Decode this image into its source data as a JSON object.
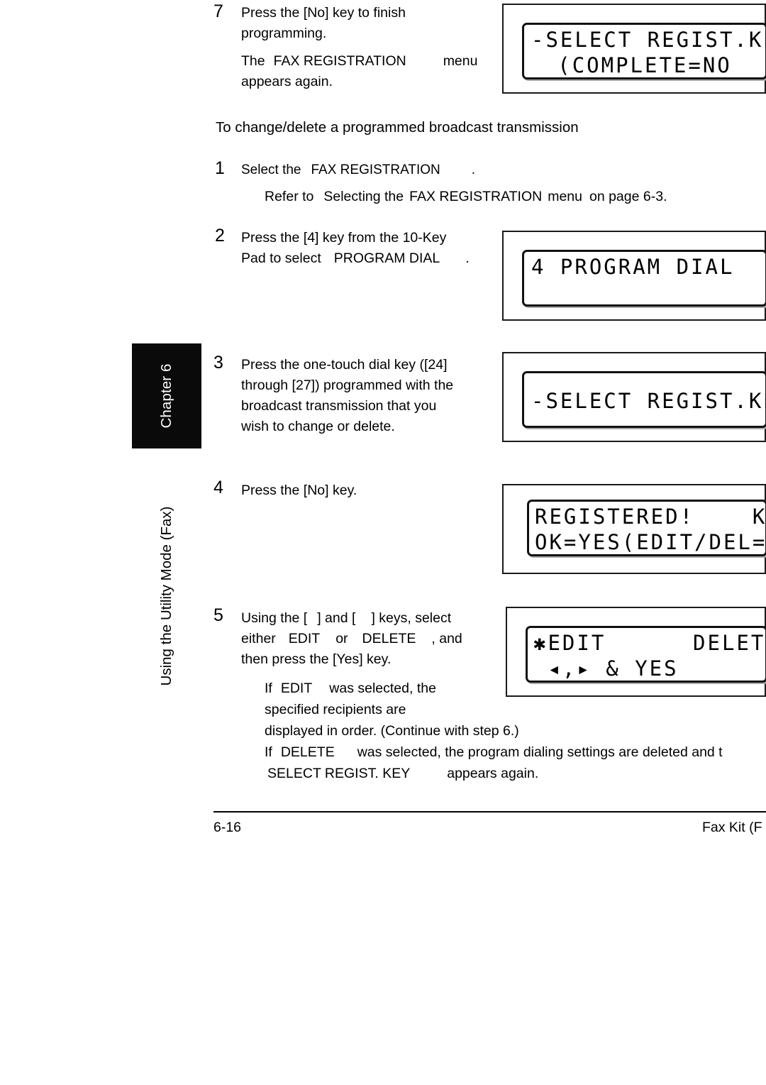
{
  "document": {
    "page_number": "6-16",
    "footer_right": "Fax Kit (F",
    "chapter_tab": "Chapter 6",
    "running_head": "Using the Utility Mode (Fax)"
  },
  "steps": {
    "step7": {
      "num": "7",
      "line1": "Press the [No] key to finish",
      "line2": "programming.",
      "note_a": "The",
      "note_b": "FAX REGISTRATION",
      "note_c": "menu",
      "note_d": "appears again."
    },
    "section_heading": "To change/delete a programmed broadcast transmission",
    "step1": {
      "num": "1",
      "text_a": "Select the",
      "text_b": "FAX REGISTRATION",
      "text_c": ".",
      "refer_a": "Refer to",
      "refer_b": "Selecting the",
      "refer_c": "FAX REGISTRATION",
      "refer_d": "menu",
      "refer_e": "on page 6-3."
    },
    "step2": {
      "num": "2",
      "line1": "Press the [4] key from the 10-Key",
      "line2_a": "Pad to select",
      "line2_b": "PROGRAM DIAL",
      "line2_c": "."
    },
    "step3": {
      "num": "3",
      "line1": "Press the one-touch dial key ([24]",
      "line2": "through [27]) programmed with the",
      "line3": "broadcast transmission that you",
      "line4": "wish to change or delete."
    },
    "step4": {
      "num": "4",
      "line1": "Press the [No] key."
    },
    "step5": {
      "num": "5",
      "line1_a": "Using the [",
      "line1_b": "] and [",
      "line1_c": "] keys, select",
      "line2_a": "either",
      "line2_b": "EDIT",
      "line2_c": "or",
      "line2_d": "DELETE",
      "line2_e": ", and",
      "line3": "then press the [Yes] key.",
      "sub1_a": "If",
      "sub1_b": "EDIT",
      "sub1_c": "was selected, the",
      "sub2": "specified recipients are",
      "sub3": "displayed in order. (Continue with step 6.)",
      "sub4_a": "If",
      "sub4_b": "DELETE",
      "sub4_c": "was selected, the program dialing settings are deleted and t",
      "sub5_a": "SELECT REGIST. KEY",
      "sub5_b": "appears again."
    }
  },
  "lcd_panels": [
    {
      "id": "panel-select-regist-key-complete",
      "line1": "-SELECT REGIST.KEY-",
      "line2": "(COMPLETE=NO"
    },
    {
      "id": "panel-program-dial",
      "line1": "4 PROGRAM DIAL",
      "line2": ""
    },
    {
      "id": "panel-select-regist-key",
      "line1": "-SELECT REGIST.KEY-",
      "line2": ""
    },
    {
      "id": "panel-registered-keep",
      "line1": "REGISTERED!    KEEP",
      "line2": "OK=YES(EDIT/DEL=NO"
    },
    {
      "id": "panel-edit-delete",
      "line1": "✱EDIT      DELETE",
      "line2": " ◂,▸ & YES"
    }
  ]
}
